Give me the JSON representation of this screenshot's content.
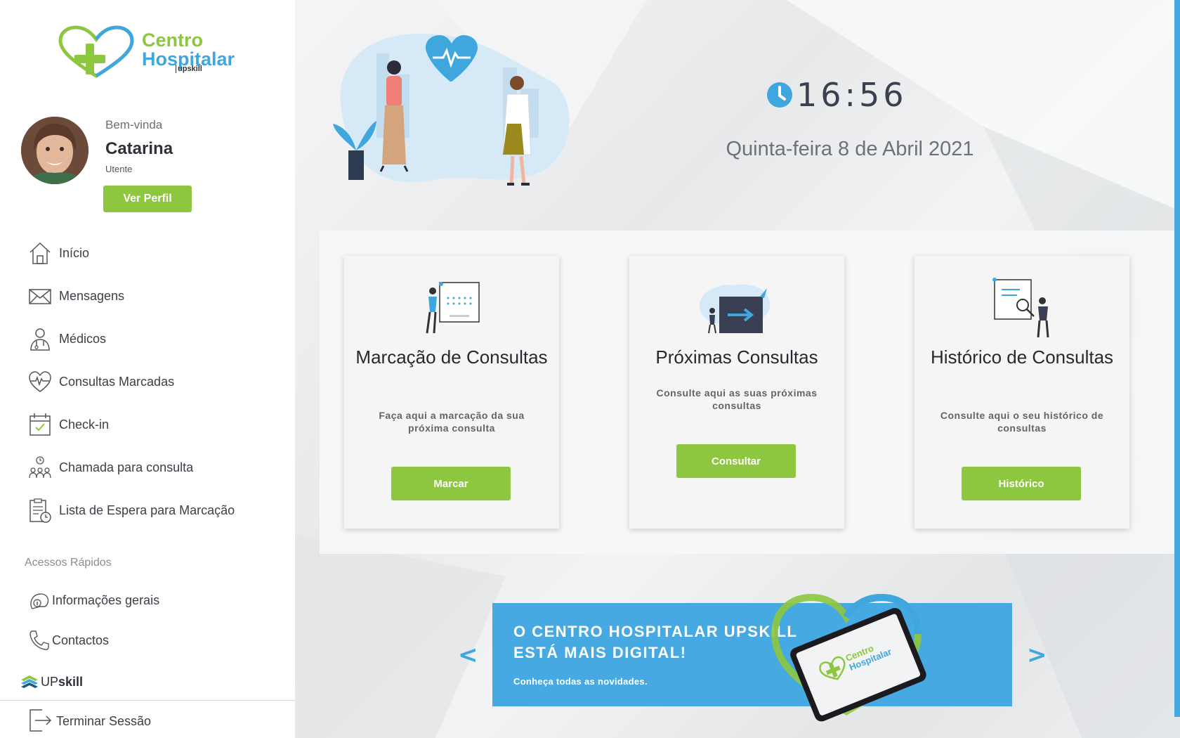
{
  "brand": {
    "line1": "Centro",
    "line2": "Hospitalar",
    "line3": "upskill",
    "green": "#8dc63f",
    "blue": "#3fa7dd"
  },
  "user": {
    "greeting": "Bem-vinda",
    "name": "Catarina",
    "role": "Utente",
    "profile_button": "Ver Perfil"
  },
  "nav": {
    "items": [
      {
        "label": "Início",
        "icon": "home-icon"
      },
      {
        "label": "Mensagens",
        "icon": "envelope-icon"
      },
      {
        "label": "Médicos",
        "icon": "doctor-icon"
      },
      {
        "label": "Consultas Marcadas",
        "icon": "heart-pulse-icon"
      },
      {
        "label": "Check-in",
        "icon": "calendar-check-icon"
      },
      {
        "label": "Chamada para consulta",
        "icon": "waiting-room-icon"
      },
      {
        "label": "Lista de Espera para Marcação",
        "icon": "clipboard-clock-icon"
      }
    ]
  },
  "quick_access": {
    "title": "Acessos Rápidos",
    "items": [
      {
        "label": "Informações gerais",
        "icon": "info-icon"
      },
      {
        "label": "Contactos",
        "icon": "phone-icon"
      }
    ]
  },
  "footer": {
    "upskill_prefix": "UP",
    "upskill_suffix": "skill",
    "logout": "Terminar Sessão"
  },
  "clock": {
    "time": "16:56",
    "date": "Quinta-feira 8 de Abril 2021"
  },
  "cards": [
    {
      "title": "Marcação de Consultas",
      "description": "Faça aqui a marcação da sua próxima consulta",
      "button": "Marcar"
    },
    {
      "title": "Próximas Consultas",
      "description": "Consulte aqui as suas próximas consultas",
      "button": "Consultar"
    },
    {
      "title": "Histórico de Consultas",
      "description": "Consulte aqui o seu histórico de consultas",
      "button": "Histórico"
    }
  ],
  "banner": {
    "title": "O CENTRO HOSPITALAR UPSKILL ESTÁ MAIS DIGITAL!",
    "subtitle": "Conheça todas as novidades.",
    "prev": "<",
    "next": ">",
    "tablet_logo_line1": "Centro",
    "tablet_logo_line2": "Hospitalar"
  }
}
